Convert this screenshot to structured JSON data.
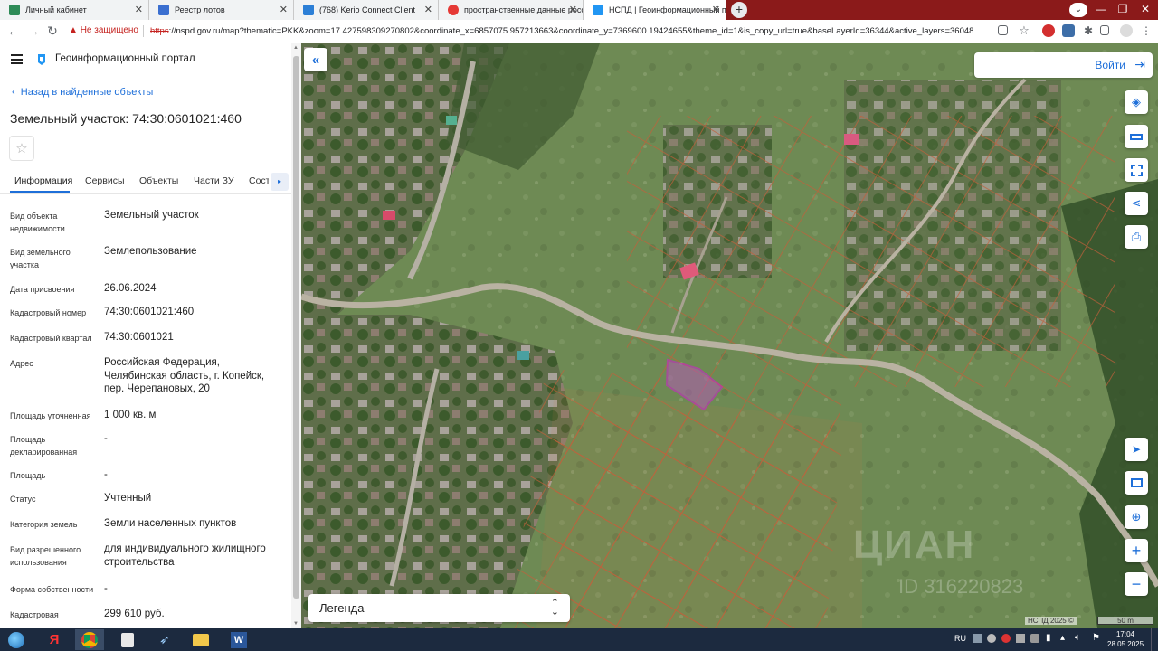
{
  "browser": {
    "tabs": [
      {
        "title": "Личный кабинет",
        "fav_color": "#2e8b57"
      },
      {
        "title": "Реестр лотов",
        "fav_color": "#3b6fd0"
      },
      {
        "title": "(768) Kerio Connect Client",
        "fav_color": "#2c7fd6"
      },
      {
        "title": "пространственные данные росс",
        "fav_color": "#e53935"
      },
      {
        "title": "НСПД | Геоинформационный п",
        "fav_color": "#2196f3"
      }
    ],
    "security_label": "Не защищено",
    "url_scheme": "https",
    "url_rest": "://nspd.gov.ru/map?thematic=PKK&zoom=17.427598309270802&coordinate_x=6857075.957213663&coordinate_y=7369600.19424655&theme_id=1&is_copy_url=true&baseLayerId=36344&active_layers=36048"
  },
  "portal": {
    "title": "Геоинформационный портал",
    "back_link": "Назад в найденные объекты",
    "object_title": "Земельный участок: 74:30:0601021:460",
    "tabs": [
      "Информация",
      "Сервисы",
      "Объекты",
      "Части ЗУ",
      "Состав"
    ],
    "fields": [
      {
        "label": "Вид объекта недвижимости",
        "value": "Земельный участок"
      },
      {
        "label": "Вид земельного участка",
        "value": "Землепользование"
      },
      {
        "label": "Дата присвоения",
        "value": "26.06.2024"
      },
      {
        "label": "Кадастровый номер",
        "value": "74:30:0601021:460"
      },
      {
        "label": "Кадастровый квартал",
        "value": "74:30:0601021"
      },
      {
        "label": "Адрес",
        "value": "Российская Федерация, Челябинская область, г. Копейск, пер. Черепановых, 20"
      },
      {
        "label": "Площадь уточненная",
        "value": "1 000 кв. м"
      },
      {
        "label": "Площадь декларированная",
        "value": "-"
      },
      {
        "label": "Площадь",
        "value": "-"
      },
      {
        "label": "Статус",
        "value": "Учтенный"
      },
      {
        "label": "Категория земель",
        "value": "Земли населенных пунктов"
      },
      {
        "label": "Вид разрешенного использования",
        "value": "для индивидуального жилищного строительства"
      },
      {
        "label": "Форма собственности",
        "value": "-"
      },
      {
        "label": "Кадастровая",
        "value": "299 610 руб."
      }
    ]
  },
  "map": {
    "login_label": "Войти",
    "legend_label": "Легенда",
    "attribution": "НСПД 2025 ©",
    "scale_label": "50 m",
    "watermark": "ЦИАН",
    "watermark_id": "ID 316220823"
  },
  "taskbar": {
    "lang": "RU",
    "time": "17:04",
    "date": "28.05.2025"
  }
}
